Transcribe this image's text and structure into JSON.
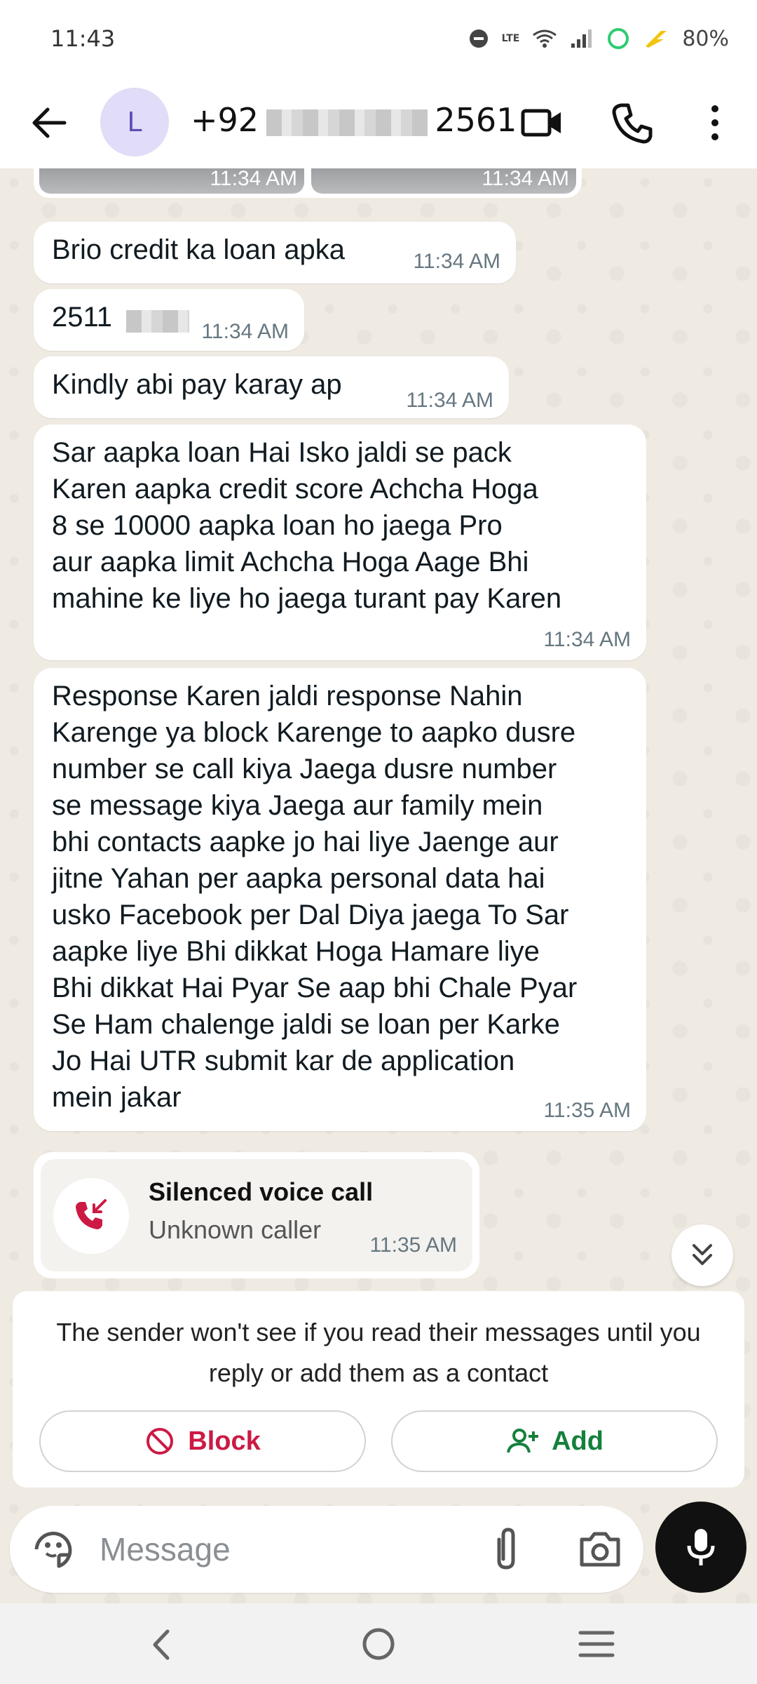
{
  "status_bar": {
    "time": "11:43",
    "network": "LTE",
    "battery": "80%"
  },
  "header": {
    "avatar_letter": "L",
    "contact_prefix": "+92",
    "contact_suffix": "2561"
  },
  "media": {
    "times": [
      "11:34 AM",
      "11:34 AM"
    ]
  },
  "messages": [
    {
      "text": "Brio credit ka loan apka",
      "time": "11:34 AM"
    },
    {
      "text": "2511",
      "time": "11:34 AM"
    },
    {
      "text": "Kindly abi pay karay ap",
      "time": "11:34 AM"
    },
    {
      "text": "Sar aapka loan Hai Isko jaldi se pack\nKaren aapka credit score Achcha Hoga\n8 se 10000 aapka loan ho jaega Pro\naur aapka limit Achcha Hoga Aage Bhi\nmahine ke liye ho jaega turant pay Karen",
      "time": "11:34 AM"
    },
    {
      "text": "Response Karen jaldi response Nahin\nKarenge ya block Karenge to aapko dusre\nnumber se call kiya Jaega dusre number\nse message kiya Jaega aur family mein\nbhi contacts aapke jo hai liye Jaenge aur\njitne Yahan per aapka personal data hai\nusko Facebook per Dal Diya jaega To Sar\naapke liye Bhi dikkat Hoga Hamare liye\nBhi dikkat Hai Pyar Se aap bhi Chale Pyar\nSe Ham chalenge jaldi se loan per Karke\nJo Hai UTR submit kar de application\nmein jakar",
      "time": "11:35 AM"
    }
  ],
  "call": {
    "title": "Silenced voice call",
    "subtitle": "Unknown caller",
    "time": "11:35 AM"
  },
  "notice": {
    "text": "The sender won't see if you read their messages until you reply or add them as a contact",
    "block_label": "Block",
    "add_label": "Add"
  },
  "composer": {
    "placeholder": "Message"
  },
  "colors": {
    "block": "#cc1a44",
    "add": "#15803d",
    "chat_bg": "#efeae2",
    "avatar_bg": "#e1dcf7"
  }
}
